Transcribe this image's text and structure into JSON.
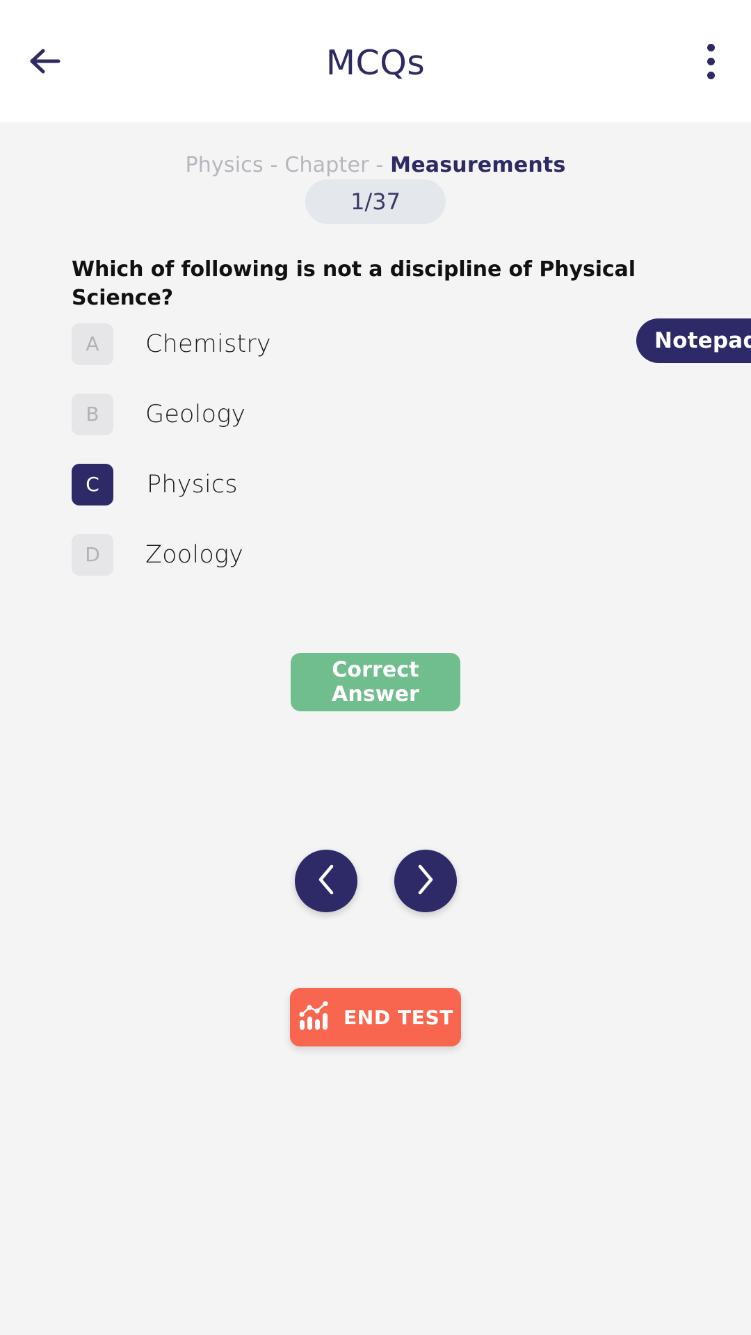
{
  "appbar": {
    "title": "MCQs",
    "back_icon": "arrow-left-icon",
    "menu_icon": "more-vertical-icon"
  },
  "breadcrumb": {
    "subject": "Physics",
    "separator_1": " - ",
    "chapter_word": "Chapter",
    "separator_2": " - ",
    "chapter_name": "Measurements"
  },
  "notepad": {
    "label": "Notepad"
  },
  "counter": {
    "value": "1/37"
  },
  "question": {
    "text": "Which of following is not a discipline of Physical Science?"
  },
  "options": [
    {
      "key": "A",
      "label": "Chemistry",
      "selected": false
    },
    {
      "key": "B",
      "label": "Geology",
      "selected": false
    },
    {
      "key": "C",
      "label": "Physics",
      "selected": true
    },
    {
      "key": "D",
      "label": "Zoology",
      "selected": false
    }
  ],
  "correct_answer_button": {
    "label": "Correct Answer"
  },
  "navigation": {
    "prev_icon": "chevron-left-icon",
    "next_icon": "chevron-right-icon"
  },
  "end_test_button": {
    "label": "END TEST",
    "icon": "bar-chart-icon"
  },
  "colors": {
    "navy": "#2e2a68",
    "page_background": "#f4f4f5",
    "appbar_background": "#ffffff",
    "counter_pill": "#e4e7ec",
    "option_badge": "#e6e6e9",
    "correct_green": "#70be8d",
    "end_test_coral": "#f9664f",
    "muted_text": "#b6b6bd"
  }
}
